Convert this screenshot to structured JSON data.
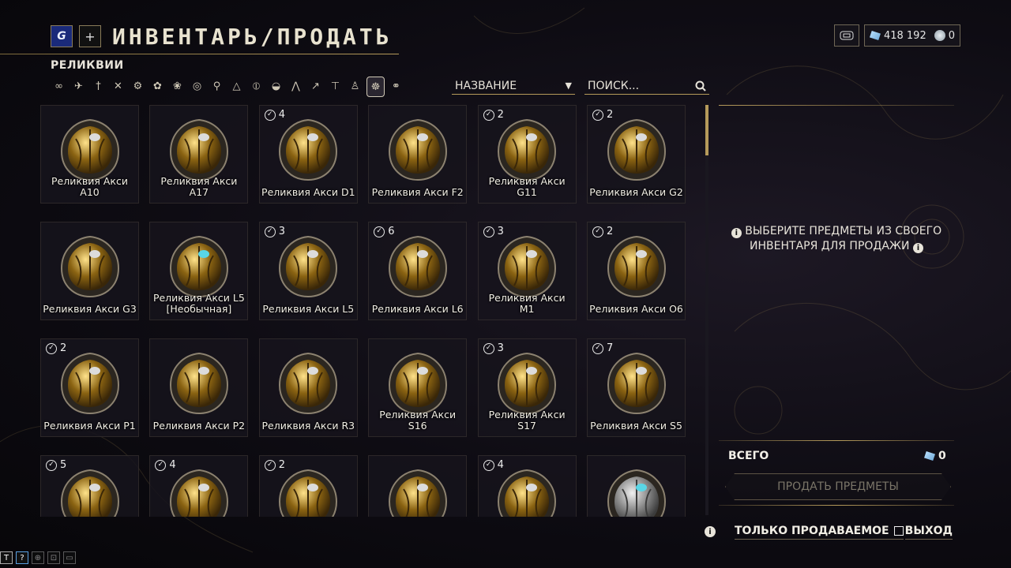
{
  "header": {
    "logo": "G",
    "add": "+",
    "title": "ИНВЕНТАРЬ/ПРОДАТЬ"
  },
  "currency": {
    "platinum": "418 192",
    "credits": "0"
  },
  "section_label": "РЕЛИКВИИ",
  "filters": [
    "∞",
    "✈",
    "†",
    "✕",
    "⚙",
    "✿",
    "❀",
    "◎",
    "⚲",
    "△",
    "⦶",
    "◒",
    "⋀",
    "↗",
    "⊤",
    "♙",
    "☸",
    "⚭"
  ],
  "sort": {
    "label": "НАЗВАНИЕ",
    "arrow": "▼"
  },
  "search": {
    "placeholder": "ПОИСК..."
  },
  "items": [
    {
      "name": "Реликвия Акси A10",
      "count": ""
    },
    {
      "name": "Реликвия Акси A17",
      "count": ""
    },
    {
      "name": "Реликвия Акси D1",
      "count": "4"
    },
    {
      "name": "Реликвия Акси F2",
      "count": ""
    },
    {
      "name": "Реликвия Акси G11",
      "count": "2"
    },
    {
      "name": "Реликвия Акси G2",
      "count": "2"
    },
    {
      "name": "Реликвия Акси G3",
      "count": ""
    },
    {
      "name": "Реликвия Акси L5 [Необычная]",
      "count": ""
    },
    {
      "name": "Реликвия Акси L5",
      "count": "3"
    },
    {
      "name": "Реликвия Акси L6",
      "count": "6"
    },
    {
      "name": "Реликвия Акси M1",
      "count": "3"
    },
    {
      "name": "Реликвия Акси O6",
      "count": "2"
    },
    {
      "name": "Реликвия Акси P1",
      "count": "2"
    },
    {
      "name": "Реликвия Акси P2",
      "count": ""
    },
    {
      "name": "Реликвия Акси R3",
      "count": ""
    },
    {
      "name": "Реликвия Акси S16",
      "count": ""
    },
    {
      "name": "Реликвия Акси S17",
      "count": "3"
    },
    {
      "name": "Реликвия Акси S5",
      "count": "7"
    },
    {
      "name": "",
      "count": "5"
    },
    {
      "name": "",
      "count": "4"
    },
    {
      "name": "",
      "count": "2"
    },
    {
      "name": "",
      "count": ""
    },
    {
      "name": "",
      "count": "4"
    },
    {
      "name": "",
      "count": ""
    }
  ],
  "right_panel": {
    "message": "ВЫБЕРИТЕ ПРЕДМЕТЫ ИЗ СВОЕГО ИНВЕНТАРЯ ДЛЯ ПРОДАЖИ",
    "total_label": "ВСЕГО",
    "total_value": "0",
    "sell_button": "ПРОДАТЬ ПРЕДМЕТЫ"
  },
  "bottom": {
    "info": "i",
    "only_sellable": "ТОЛЬКО ПРОДАВАЕМОЕ",
    "exit": "ВЫХОД"
  },
  "toolbar": [
    "T",
    "?",
    "⊕",
    "⊡",
    "▭"
  ]
}
